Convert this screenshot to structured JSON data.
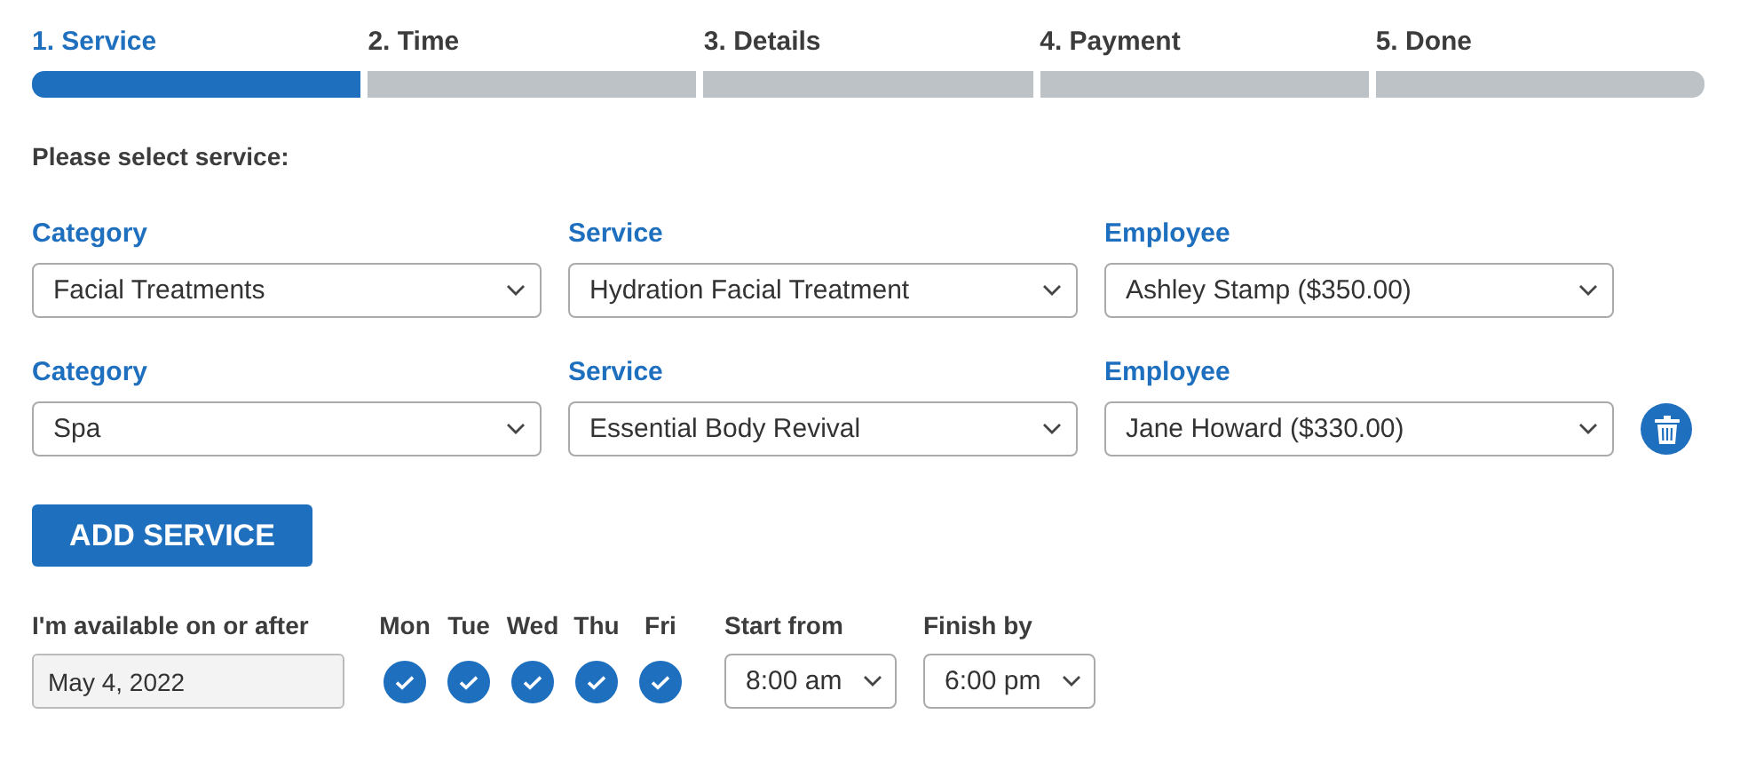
{
  "steps": [
    {
      "label": "1. Service",
      "selected": true
    },
    {
      "label": "2. Time",
      "selected": false
    },
    {
      "label": "3. Details",
      "selected": false
    },
    {
      "label": "4. Payment",
      "selected": false
    },
    {
      "label": "5. Done",
      "selected": false
    }
  ],
  "prompt": "Please select service:",
  "service_rows": [
    {
      "fields": [
        {
          "label": "Category",
          "value": "Facial Treatments"
        },
        {
          "label": "Service",
          "value": "Hydration Facial Treatment"
        },
        {
          "label": "Employee",
          "value": "Ashley Stamp ($350.00)"
        }
      ],
      "removable": false
    },
    {
      "fields": [
        {
          "label": "Category",
          "value": "Spa"
        },
        {
          "label": "Service",
          "value": "Essential Body Revival"
        },
        {
          "label": "Employee",
          "value": "Jane Howard ($330.00)"
        }
      ],
      "removable": true
    }
  ],
  "add_button": "ADD SERVICE",
  "availability": {
    "label": "I'm available on or after",
    "date": "May 4, 2022"
  },
  "days": [
    {
      "label": "Mon",
      "checked": true
    },
    {
      "label": "Tue",
      "checked": true
    },
    {
      "label": "Wed",
      "checked": true
    },
    {
      "label": "Thu",
      "checked": true
    },
    {
      "label": "Fri",
      "checked": true
    }
  ],
  "start": {
    "label": "Start from",
    "value": "8:00 am"
  },
  "finish": {
    "label": "Finish by",
    "value": "6:00 pm"
  }
}
